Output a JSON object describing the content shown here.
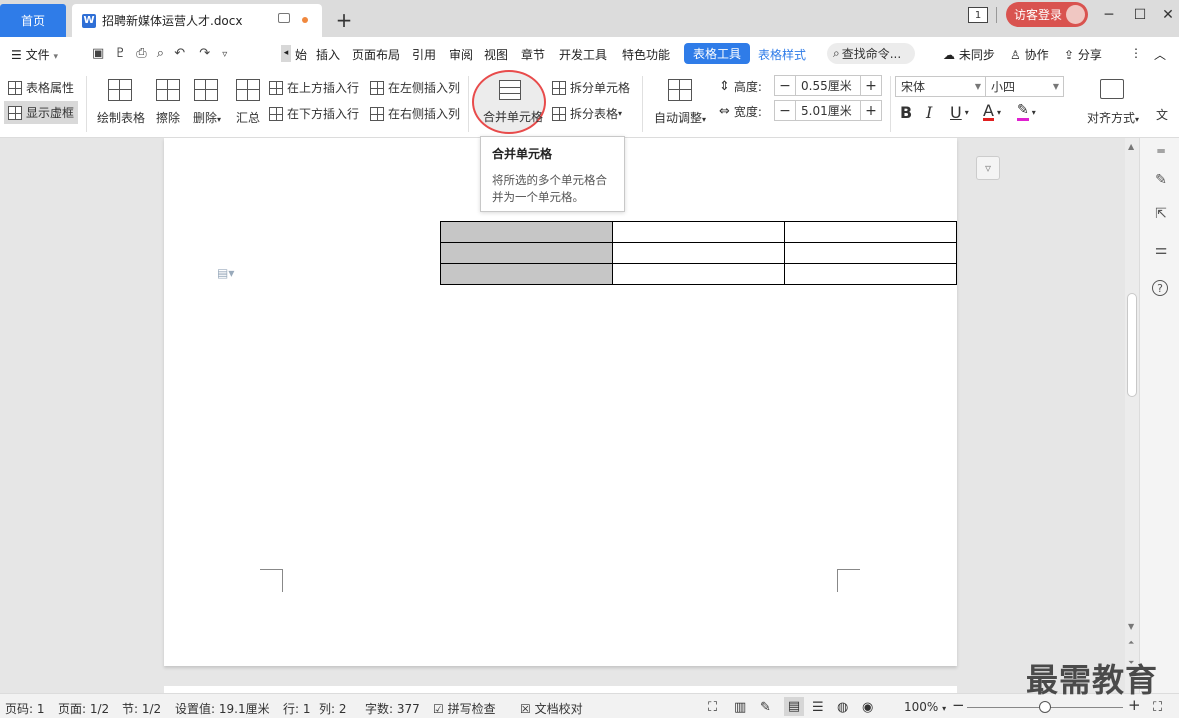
{
  "tabs": {
    "home": "首页",
    "document": "招聘新媒体运营人才.docx",
    "new_tab_icon": "plus-icon"
  },
  "titlebar": {
    "page_indicator": "1",
    "login": "访客登录"
  },
  "menu": {
    "file": "文件",
    "items": [
      "始",
      "插入",
      "页面布局",
      "引用",
      "审阅",
      "视图",
      "章节",
      "开发工具",
      "特色功能"
    ],
    "table_tools": "表格工具",
    "table_style": "表格样式",
    "search": "查找命令...",
    "unsynced": "未同步",
    "collaborate": "协作",
    "share": "分享"
  },
  "ribbon": {
    "table_props": "表格属性",
    "show_grid": "显示虚框",
    "draw_table": "绘制表格",
    "erase": "擦除",
    "delete": "删除",
    "summary": "汇总",
    "insert_above": "在上方插入行",
    "insert_below": "在下方插入行",
    "insert_left": "在左侧插入列",
    "insert_right": "在右侧插入列",
    "merge_cells": "合并单元格",
    "split_cells": "拆分单元格",
    "split_table": "拆分表格",
    "auto_fit": "自动调整",
    "height_label": "高度:",
    "height_value": "0.55厘米",
    "width_label": "宽度:",
    "width_value": "5.01厘米",
    "font_name": "宋体",
    "font_size": "小四",
    "bold": "B",
    "italic": "I",
    "underline": "U",
    "font_color": "A",
    "align": "对齐方式",
    "text_dir": "文"
  },
  "tooltip": {
    "title": "合并单元格",
    "desc": "将所选的多个单元格合并为一个单元格。"
  },
  "status": {
    "page_code": "页码: 1",
    "page": "页面: 1/2",
    "section": "节: 1/2",
    "setting": "设置值: 19.1厘米",
    "row": "行: 1",
    "col": "列: 2",
    "word_count": "字数: 377",
    "spell_check": "拼写检查",
    "doc_proof": "文档校对",
    "zoom": "100%"
  },
  "zoom_fraction": 0.5,
  "watermark": "最需教育",
  "colors": {
    "accent": "#2f7ce8",
    "login": "#d9534f",
    "highlight_circle": "#e84b4b",
    "selected_cell": "#c6c6c6"
  }
}
